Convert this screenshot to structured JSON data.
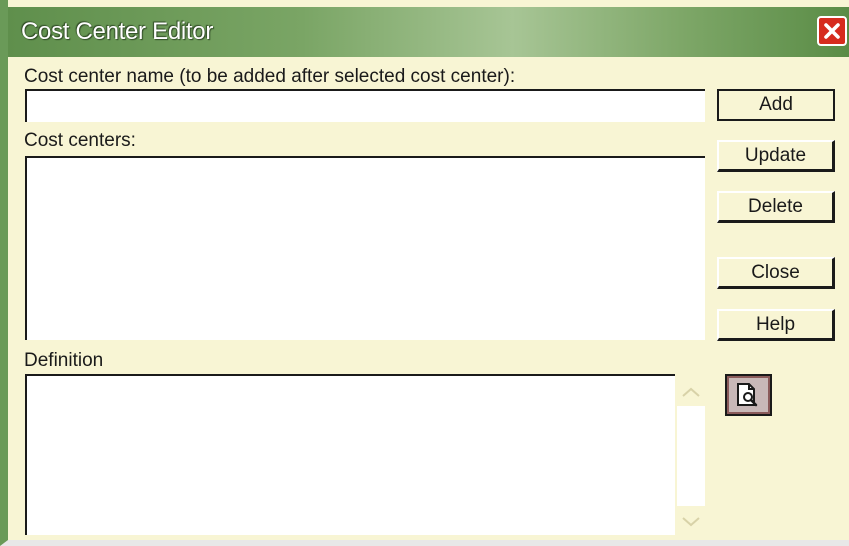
{
  "window": {
    "title": "Cost Center Editor",
    "close_icon": "close-x-icon"
  },
  "form": {
    "name_label": "Cost center name (to be added after selected cost center):",
    "name_value": "",
    "list_label": "Cost centers:",
    "cost_centers": [],
    "definition_label": "Definition",
    "definition_value": ""
  },
  "buttons": {
    "add": "Add",
    "update": "Update",
    "delete": "Delete",
    "close": "Close",
    "help": "Help",
    "preview_icon": "document-magnifier-icon"
  },
  "colors": {
    "titlebar": "#6a9a58",
    "body": "#f8f5d4",
    "close": "#d62b1e"
  }
}
